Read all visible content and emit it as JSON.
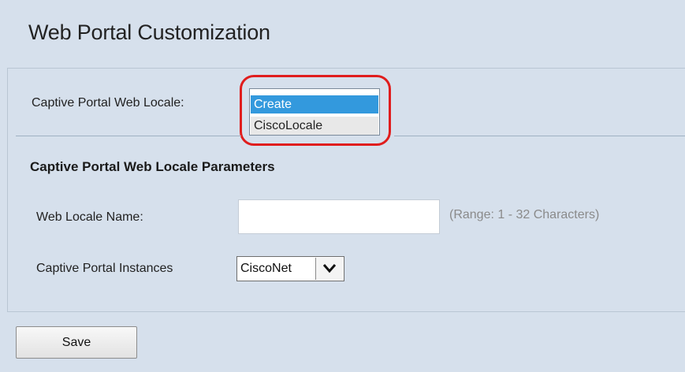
{
  "page": {
    "title": "Web Portal Customization"
  },
  "locale_selector": {
    "label": "Captive Portal Web Locale:",
    "options": [
      "Create",
      "CiscoLocale"
    ],
    "selected": "Create"
  },
  "parameters": {
    "heading": "Captive Portal Web Locale Parameters",
    "web_locale_name": {
      "label": "Web Locale Name:",
      "value": "",
      "hint": "(Range: 1 - 32 Characters)"
    },
    "instances": {
      "label": "Captive Portal Instances",
      "selected": "CiscoNet"
    }
  },
  "actions": {
    "save_label": "Save"
  },
  "colors": {
    "background": "#d6e0ec",
    "selection": "#3399dd",
    "highlight_ring": "#e01d1d"
  }
}
